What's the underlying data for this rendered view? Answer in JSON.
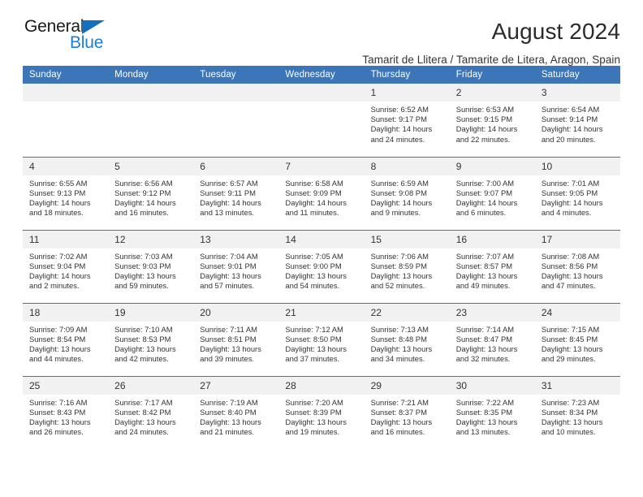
{
  "brand": {
    "name_top": "General",
    "name_bottom": "Blue",
    "triangle_color": "#1470bd",
    "blue_color": "#1a7fd4"
  },
  "header": {
    "title": "August 2024",
    "subtitle": "Tamarit de Llitera / Tamarite de Litera, Aragon, Spain"
  },
  "colors": {
    "header_bar": "#3c75b8",
    "daynum_band": "#f1f1f1",
    "text": "#333333"
  },
  "weekdays": [
    "Sunday",
    "Monday",
    "Tuesday",
    "Wednesday",
    "Thursday",
    "Friday",
    "Saturday"
  ],
  "weeks": [
    [
      {
        "day": "",
        "sunrise": "",
        "sunset": "",
        "daylight1": "",
        "daylight2": ""
      },
      {
        "day": "",
        "sunrise": "",
        "sunset": "",
        "daylight1": "",
        "daylight2": ""
      },
      {
        "day": "",
        "sunrise": "",
        "sunset": "",
        "daylight1": "",
        "daylight2": ""
      },
      {
        "day": "",
        "sunrise": "",
        "sunset": "",
        "daylight1": "",
        "daylight2": ""
      },
      {
        "day": "1",
        "sunrise": "Sunrise: 6:52 AM",
        "sunset": "Sunset: 9:17 PM",
        "daylight1": "Daylight: 14 hours",
        "daylight2": "and 24 minutes."
      },
      {
        "day": "2",
        "sunrise": "Sunrise: 6:53 AM",
        "sunset": "Sunset: 9:15 PM",
        "daylight1": "Daylight: 14 hours",
        "daylight2": "and 22 minutes."
      },
      {
        "day": "3",
        "sunrise": "Sunrise: 6:54 AM",
        "sunset": "Sunset: 9:14 PM",
        "daylight1": "Daylight: 14 hours",
        "daylight2": "and 20 minutes."
      }
    ],
    [
      {
        "day": "4",
        "sunrise": "Sunrise: 6:55 AM",
        "sunset": "Sunset: 9:13 PM",
        "daylight1": "Daylight: 14 hours",
        "daylight2": "and 18 minutes."
      },
      {
        "day": "5",
        "sunrise": "Sunrise: 6:56 AM",
        "sunset": "Sunset: 9:12 PM",
        "daylight1": "Daylight: 14 hours",
        "daylight2": "and 16 minutes."
      },
      {
        "day": "6",
        "sunrise": "Sunrise: 6:57 AM",
        "sunset": "Sunset: 9:11 PM",
        "daylight1": "Daylight: 14 hours",
        "daylight2": "and 13 minutes."
      },
      {
        "day": "7",
        "sunrise": "Sunrise: 6:58 AM",
        "sunset": "Sunset: 9:09 PM",
        "daylight1": "Daylight: 14 hours",
        "daylight2": "and 11 minutes."
      },
      {
        "day": "8",
        "sunrise": "Sunrise: 6:59 AM",
        "sunset": "Sunset: 9:08 PM",
        "daylight1": "Daylight: 14 hours",
        "daylight2": "and 9 minutes."
      },
      {
        "day": "9",
        "sunrise": "Sunrise: 7:00 AM",
        "sunset": "Sunset: 9:07 PM",
        "daylight1": "Daylight: 14 hours",
        "daylight2": "and 6 minutes."
      },
      {
        "day": "10",
        "sunrise": "Sunrise: 7:01 AM",
        "sunset": "Sunset: 9:05 PM",
        "daylight1": "Daylight: 14 hours",
        "daylight2": "and 4 minutes."
      }
    ],
    [
      {
        "day": "11",
        "sunrise": "Sunrise: 7:02 AM",
        "sunset": "Sunset: 9:04 PM",
        "daylight1": "Daylight: 14 hours",
        "daylight2": "and 2 minutes."
      },
      {
        "day": "12",
        "sunrise": "Sunrise: 7:03 AM",
        "sunset": "Sunset: 9:03 PM",
        "daylight1": "Daylight: 13 hours",
        "daylight2": "and 59 minutes."
      },
      {
        "day": "13",
        "sunrise": "Sunrise: 7:04 AM",
        "sunset": "Sunset: 9:01 PM",
        "daylight1": "Daylight: 13 hours",
        "daylight2": "and 57 minutes."
      },
      {
        "day": "14",
        "sunrise": "Sunrise: 7:05 AM",
        "sunset": "Sunset: 9:00 PM",
        "daylight1": "Daylight: 13 hours",
        "daylight2": "and 54 minutes."
      },
      {
        "day": "15",
        "sunrise": "Sunrise: 7:06 AM",
        "sunset": "Sunset: 8:59 PM",
        "daylight1": "Daylight: 13 hours",
        "daylight2": "and 52 minutes."
      },
      {
        "day": "16",
        "sunrise": "Sunrise: 7:07 AM",
        "sunset": "Sunset: 8:57 PM",
        "daylight1": "Daylight: 13 hours",
        "daylight2": "and 49 minutes."
      },
      {
        "day": "17",
        "sunrise": "Sunrise: 7:08 AM",
        "sunset": "Sunset: 8:56 PM",
        "daylight1": "Daylight: 13 hours",
        "daylight2": "and 47 minutes."
      }
    ],
    [
      {
        "day": "18",
        "sunrise": "Sunrise: 7:09 AM",
        "sunset": "Sunset: 8:54 PM",
        "daylight1": "Daylight: 13 hours",
        "daylight2": "and 44 minutes."
      },
      {
        "day": "19",
        "sunrise": "Sunrise: 7:10 AM",
        "sunset": "Sunset: 8:53 PM",
        "daylight1": "Daylight: 13 hours",
        "daylight2": "and 42 minutes."
      },
      {
        "day": "20",
        "sunrise": "Sunrise: 7:11 AM",
        "sunset": "Sunset: 8:51 PM",
        "daylight1": "Daylight: 13 hours",
        "daylight2": "and 39 minutes."
      },
      {
        "day": "21",
        "sunrise": "Sunrise: 7:12 AM",
        "sunset": "Sunset: 8:50 PM",
        "daylight1": "Daylight: 13 hours",
        "daylight2": "and 37 minutes."
      },
      {
        "day": "22",
        "sunrise": "Sunrise: 7:13 AM",
        "sunset": "Sunset: 8:48 PM",
        "daylight1": "Daylight: 13 hours",
        "daylight2": "and 34 minutes."
      },
      {
        "day": "23",
        "sunrise": "Sunrise: 7:14 AM",
        "sunset": "Sunset: 8:47 PM",
        "daylight1": "Daylight: 13 hours",
        "daylight2": "and 32 minutes."
      },
      {
        "day": "24",
        "sunrise": "Sunrise: 7:15 AM",
        "sunset": "Sunset: 8:45 PM",
        "daylight1": "Daylight: 13 hours",
        "daylight2": "and 29 minutes."
      }
    ],
    [
      {
        "day": "25",
        "sunrise": "Sunrise: 7:16 AM",
        "sunset": "Sunset: 8:43 PM",
        "daylight1": "Daylight: 13 hours",
        "daylight2": "and 26 minutes."
      },
      {
        "day": "26",
        "sunrise": "Sunrise: 7:17 AM",
        "sunset": "Sunset: 8:42 PM",
        "daylight1": "Daylight: 13 hours",
        "daylight2": "and 24 minutes."
      },
      {
        "day": "27",
        "sunrise": "Sunrise: 7:19 AM",
        "sunset": "Sunset: 8:40 PM",
        "daylight1": "Daylight: 13 hours",
        "daylight2": "and 21 minutes."
      },
      {
        "day": "28",
        "sunrise": "Sunrise: 7:20 AM",
        "sunset": "Sunset: 8:39 PM",
        "daylight1": "Daylight: 13 hours",
        "daylight2": "and 19 minutes."
      },
      {
        "day": "29",
        "sunrise": "Sunrise: 7:21 AM",
        "sunset": "Sunset: 8:37 PM",
        "daylight1": "Daylight: 13 hours",
        "daylight2": "and 16 minutes."
      },
      {
        "day": "30",
        "sunrise": "Sunrise: 7:22 AM",
        "sunset": "Sunset: 8:35 PM",
        "daylight1": "Daylight: 13 hours",
        "daylight2": "and 13 minutes."
      },
      {
        "day": "31",
        "sunrise": "Sunrise: 7:23 AM",
        "sunset": "Sunset: 8:34 PM",
        "daylight1": "Daylight: 13 hours",
        "daylight2": "and 10 minutes."
      }
    ]
  ]
}
